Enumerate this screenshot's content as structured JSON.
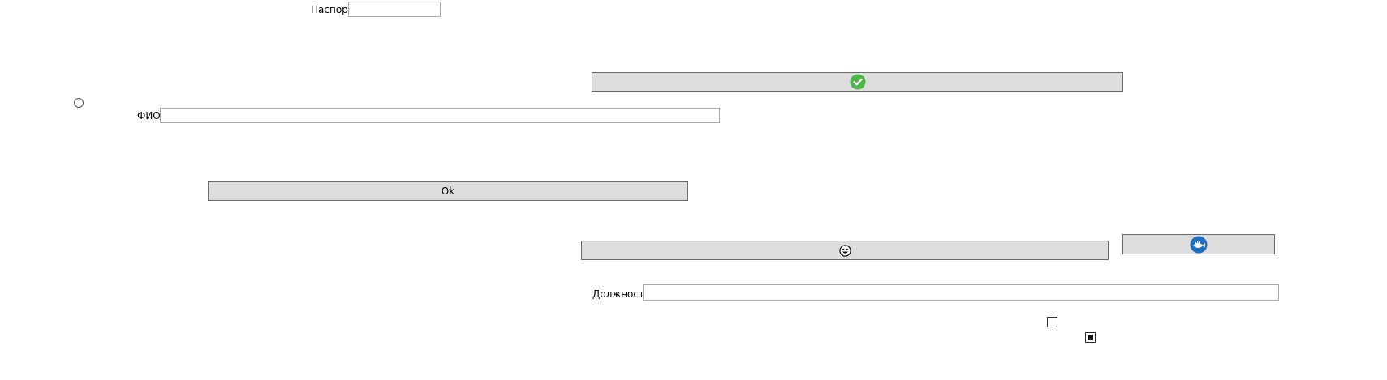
{
  "passport": {
    "label": "Паспорт",
    "value": ""
  },
  "confirm_button": {
    "icon": "green-check-circle-icon",
    "icon_color": "#4cb648"
  },
  "radio_option": {
    "checked": false
  },
  "fio": {
    "label": "ФИО",
    "value": ""
  },
  "ok_button": {
    "label": "Ok"
  },
  "emoji_button": {
    "icon": "smiley-face-icon"
  },
  "fish_button": {
    "icon": "blue-fish-circle-icon",
    "icon_color": "#1e6fbf"
  },
  "position": {
    "label": "Должность",
    "value": ""
  },
  "checkbox_1": {
    "state": "unchecked"
  },
  "checkbox_2": {
    "state": "indeterminate"
  }
}
